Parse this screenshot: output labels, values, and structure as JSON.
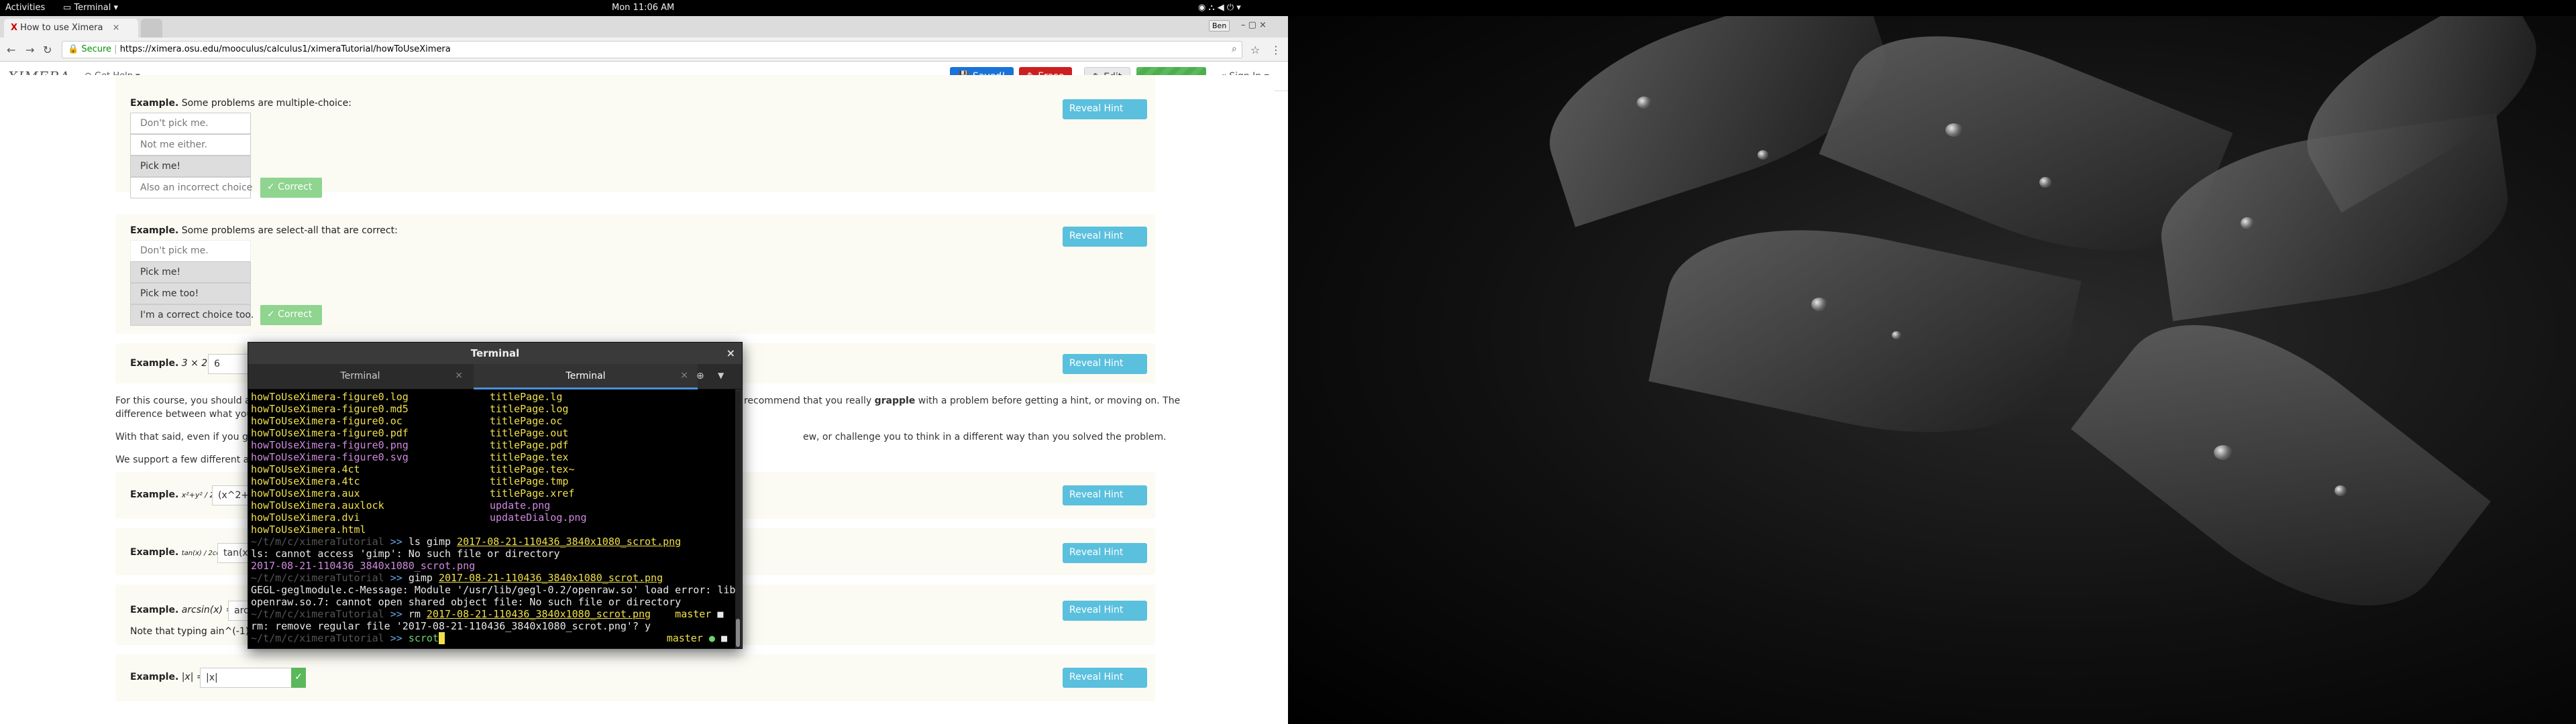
{
  "gnome": {
    "activities": "Activities",
    "app_menu": "Terminal",
    "clock": "Mon 11:06 AM"
  },
  "browser": {
    "tab_title": "How to use Ximera",
    "url_scheme": "Secure",
    "url": "https://ximera.osu.edu/mooculus/calculus1/ximeraTutorial/howToUseXimera",
    "user_chip": "Ben"
  },
  "ximera_bar": {
    "logo": "XIMERA",
    "get_help": "Get Help",
    "saved": "Saved!",
    "erase": "Erase",
    "edit": "Edit",
    "sign_in": "Sign In",
    "colors": {
      "saved": "#1a73d9",
      "erase": "#cc1f1f",
      "edit": "#e9e9e9",
      "progress": "#4cae4c"
    }
  },
  "content": {
    "ex1": {
      "label": "Example.",
      "text": "Some problems are multiple-choice:",
      "choices": [
        "Don't pick me.",
        "Not me either.",
        "Pick me!",
        "Also an incorrect choice"
      ],
      "correct": "✓ Correct"
    },
    "ex2": {
      "label": "Example.",
      "text": "Some problems are select-all that are correct:",
      "choices": [
        "Don't pick me.",
        "Pick me!",
        "Pick me too!",
        "I'm a correct choice too."
      ],
      "correct": "✓ Correct"
    },
    "ex3": {
      "label": "Example.",
      "math": "3 × 2 =",
      "value": "6"
    },
    "para1_a": "For this course, you should alw",
    "para1_b": "recommend that you really",
    "para1_bold": "grapple",
    "para1_c": "with a problem before getting a hint, or moving on. The",
    "para1_line2": "difference between what you le",
    "para2_a": "With that said, even if you get a",
    "para2_b": "ew, or challenge you to think in a different way than you solved the problem.",
    "para3": "We support a few different ans",
    "ex4": {
      "label": "Example.",
      "math": "x²+y² / 2",
      "eq": "=",
      "value": "(x^2+y"
    },
    "ex5": {
      "label": "Example.",
      "math": "tan(x) / 2cos+x²",
      "eq": "=",
      "value": "tan(x"
    },
    "ex6": {
      "label": "Example.",
      "math": "arcsin(x) =",
      "value": "arc"
    },
    "ex6_note": "Note that typing  ain^(-1)",
    "ex7": {
      "label": "Example.",
      "math": "|x| =",
      "value": "|x|"
    },
    "hint_label": "Reveal Hint"
  },
  "terminal": {
    "window_title": "Terminal",
    "tabs": [
      "Terminal",
      "Terminal"
    ],
    "files_col1": [
      "howToUseXimera-figure0.log",
      "howToUseXimera-figure0.md5",
      "howToUseXimera-figure0.oc",
      "howToUseXimera-figure0.pdf",
      "howToUseXimera-figure0.png",
      "howToUseXimera-figure0.svg",
      "howToUseXimera.4ct",
      "howToUseXimera.4tc",
      "howToUseXimera.aux",
      "howToUseXimera.auxlock",
      "howToUseXimera.dvi",
      "howToUseXimera.html"
    ],
    "files_col2": [
      "titlePage.lg",
      "titlePage.log",
      "titlePage.oc",
      "titlePage.out",
      "titlePage.pdf",
      "titlePage.tex",
      "titlePage.tex~",
      "titlePage.tmp",
      "titlePage.xref",
      "update.png",
      "updateDialog.png"
    ],
    "prompt_path": "~/t/m/c/ximeraTutorial",
    "prompt_sym": ">>",
    "cmd1": "ls gimp ",
    "cmd1_file": "2017-08-21-110436_3840x1080_scrot.png",
    "out1": "ls: cannot access 'gimp': No such file or directory",
    "out1b": "2017-08-21-110436_3840x1080_scrot.png",
    "cmd2": "gimp ",
    "cmd2_file": "2017-08-21-110436_3840x1080_scrot.png",
    "out2a": "GEGL-geglmodule.c-Message: Module '/usr/lib/gegl-0.2/openraw.so' load error: lib",
    "out2b": "openraw.so.7: cannot open shared object file: No such file or directory",
    "cmd3": "rm ",
    "cmd3_file": "2017-08-21-110436_3840x1080_scrot.png",
    "branch": "master",
    "out3": "rm: remove regular file '2017-08-21-110436_3840x1080_scrot.png'? y",
    "cmd4": "scrot"
  }
}
